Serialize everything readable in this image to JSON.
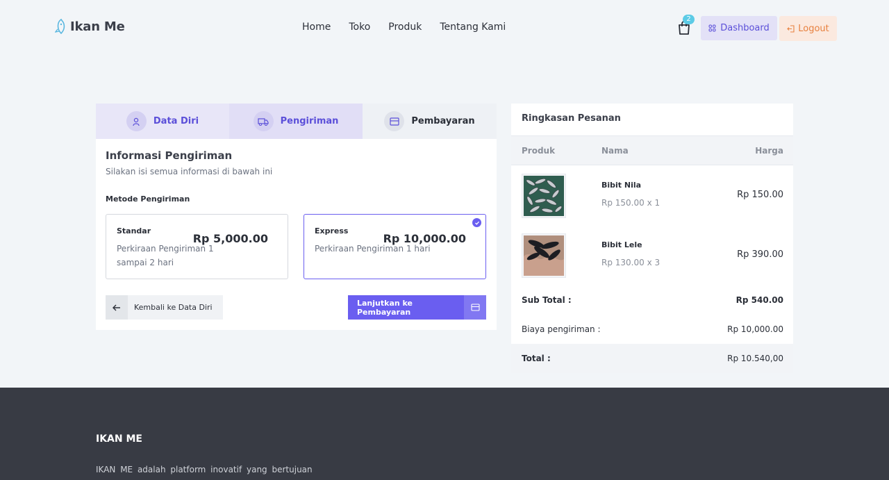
{
  "header": {
    "logo": "Ikan Me",
    "nav": [
      "Home",
      "Toko",
      "Produk",
      "Tentang Kami"
    ],
    "cart_count": "2",
    "dashboard_label": "Dashboard",
    "logout_label": "Logout"
  },
  "steps": [
    {
      "label": "Data Diri",
      "icon": "user-icon"
    },
    {
      "label": "Pengiriman",
      "icon": "truck-icon"
    },
    {
      "label": "Pembayaran",
      "icon": "card-icon"
    }
  ],
  "shipping": {
    "title": "Informasi Pengiriman",
    "subtitle": "Silakan isi semua informasi di bawah ini",
    "method_label": "Metode Pengiriman",
    "options": [
      {
        "name": "Standar",
        "estimate": "Perkiraan Pengiriman 1 sampai 2 hari",
        "price": "Rp 5,000.00",
        "selected": false
      },
      {
        "name": "Express",
        "estimate": "Perkiraan Pengiriman 1 hari",
        "price": "Rp 10,000.00",
        "selected": true
      }
    ],
    "back_label": "Kembali ke Data Diri",
    "next_label": "Lanjutkan ke Pembayaran"
  },
  "summary": {
    "title": "Ringkasan Pesanan",
    "columns": [
      "Produk",
      "Nama",
      "Harga"
    ],
    "items": [
      {
        "name": "Bibit Nila",
        "qty": "Rp 150.00 x 1",
        "price": "Rp 150.00"
      },
      {
        "name": "Bibit Lele",
        "qty": "Rp 130.00 x 3",
        "price": "Rp 390.00"
      }
    ],
    "subtotal_label": "Sub Total :",
    "subtotal": "Rp 540.00",
    "shipping_label": "Biaya pengiriman :",
    "shipping_cost": "Rp 10,000.00",
    "total_label": "Total :",
    "total": "Rp 10.540,00"
  },
  "footer": {
    "title": "IKAN ME",
    "text": "IKAN ME adalah platform inovatif yang bertujuan"
  },
  "colors": {
    "primary": "#6a5ef0",
    "accent_orange": "#e8813f",
    "footer_bg": "#383b44"
  }
}
